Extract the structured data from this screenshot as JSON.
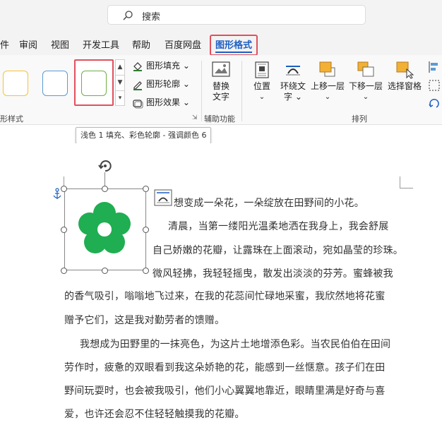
{
  "search": {
    "placeholder": "搜索"
  },
  "tabs": [
    {
      "label": "件"
    },
    {
      "label": "审阅"
    },
    {
      "label": "视图"
    },
    {
      "label": "开发工具"
    },
    {
      "label": "帮助"
    },
    {
      "label": "百度网盘"
    },
    {
      "label": "图形格式",
      "active": true
    }
  ],
  "ribbon": {
    "shape_styles_label": "形样式",
    "fill_label": "图形填充",
    "outline_label": "图形轮廓",
    "effects_label": "图形效果",
    "alt_text_label_1": "替换",
    "alt_text_label_2": "文字",
    "accessibility_label": "辅助功能",
    "position_label": "位置",
    "wrap_text_label_1": "环绕文",
    "wrap_text_label_2": "字",
    "bring_forward_label": "上移一层",
    "send_backward_label": "下移一层",
    "selection_pane_label": "选择窗格",
    "arrange_label": "排列"
  },
  "tooltip": {
    "text": "浅色 1 填充、彩色轮廓 - 强调颜色 6"
  },
  "document": {
    "lines": [
      "想变成一朵花，一朵绽放在田野间的小花。",
      "清晨，当第一缕阳光温柔地洒在我身上，我会舒展",
      "自己娇嫩的花瓣，让露珠在上面滚动，宛如晶莹的珍珠。",
      "微风轻拂，我轻轻摇曳，散发出淡淡的芬芳。蜜蜂被我",
      "的香气吸引，嗡嗡地飞过来，在我的花蕊间忙碌地采蜜，我欣然地将花蜜",
      "赠予它们，这是我对勤劳者的馈赠。",
      "我想成为田野里的一抹亮色，为这片土地增添色彩。当农民伯伯在田间",
      "劳作时，疲惫的双眼看到我这朵娇艳的花，能感到一丝惬意。孩子们在田",
      "野间玩耍时，也会被我吸引，他们小心翼翼地靠近，眼睛里满是好奇与喜",
      "爱，也许还会忍不住轻轻触摸我的花瓣。"
    ]
  },
  "colors": {
    "active_tab": "#1d5fc4",
    "highlight_border": "#e0505d",
    "flower_green": "#1fae52",
    "swatch_yellow": "#f2c438",
    "swatch_blue": "#5b9bd5",
    "swatch_green": "#70ad47"
  }
}
